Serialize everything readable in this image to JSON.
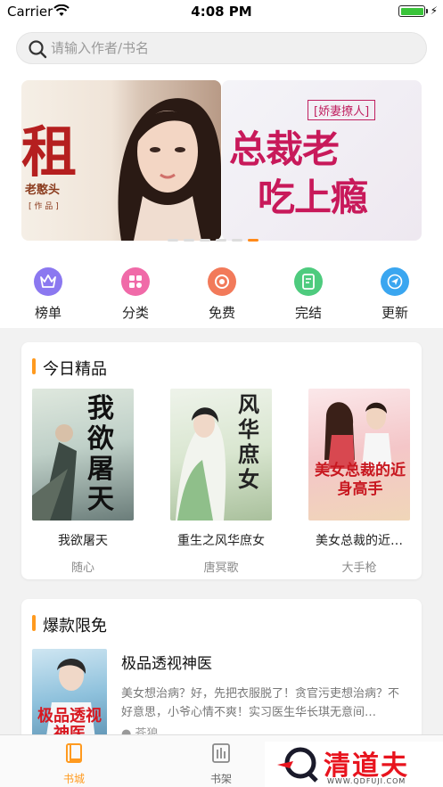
{
  "status_bar": {
    "carrier": "Carrier",
    "time": "4:08 PM"
  },
  "search": {
    "placeholder": "请输入作者/书名"
  },
  "banners": [
    {
      "big_char": "租",
      "author": "老憨头",
      "work_tag": "[ 作 品 ]"
    },
    {
      "tag": "[娇妻撩人]",
      "line1": "总裁老",
      "line2": "吃上瘾"
    }
  ],
  "banner_page_indicator": {
    "count": 6,
    "active_index": 5
  },
  "quick_nav": [
    {
      "label": "榜单",
      "icon": "crown-icon",
      "color": "#8b78f0"
    },
    {
      "label": "分类",
      "icon": "grid-icon",
      "color": "#f06aa8"
    },
    {
      "label": "免费",
      "icon": "coin-icon",
      "color": "#f27a5a"
    },
    {
      "label": "完结",
      "icon": "book-check-icon",
      "color": "#4ecb7e"
    },
    {
      "label": "更新",
      "icon": "send-icon",
      "color": "#3aa6f0"
    }
  ],
  "today_picks": {
    "title": "今日精品",
    "books": [
      {
        "title": "我欲屠天",
        "author": "随心",
        "cover_text": "我欲屠天"
      },
      {
        "title": "重生之风华庶女",
        "author": "唐冥歌",
        "cover_text": "风华庶女"
      },
      {
        "title": "美女总裁的近…",
        "author": "大手枪",
        "cover_text": "美女总裁的近身高手"
      }
    ]
  },
  "hot_free": {
    "title": "爆款限免",
    "featured": {
      "title": "极品透视神医",
      "description": "美女想治病？好，先把衣服脱了！贪官污吏想治病？不好意思，小爷心情不爽！实习医生华长琪无意间…",
      "author": "苍狼",
      "cover_text": "极品透视神医"
    }
  },
  "tab_bar": [
    {
      "label": "书城",
      "icon": "book-icon",
      "active": true
    },
    {
      "label": "书架",
      "icon": "bookshelf-icon",
      "active": false
    }
  ],
  "watermark": {
    "text": "清道夫",
    "url": "WWW.QDFUJI.COM"
  },
  "colors": {
    "accent": "#ff9a1f",
    "watermark_red": "#e8141e"
  }
}
